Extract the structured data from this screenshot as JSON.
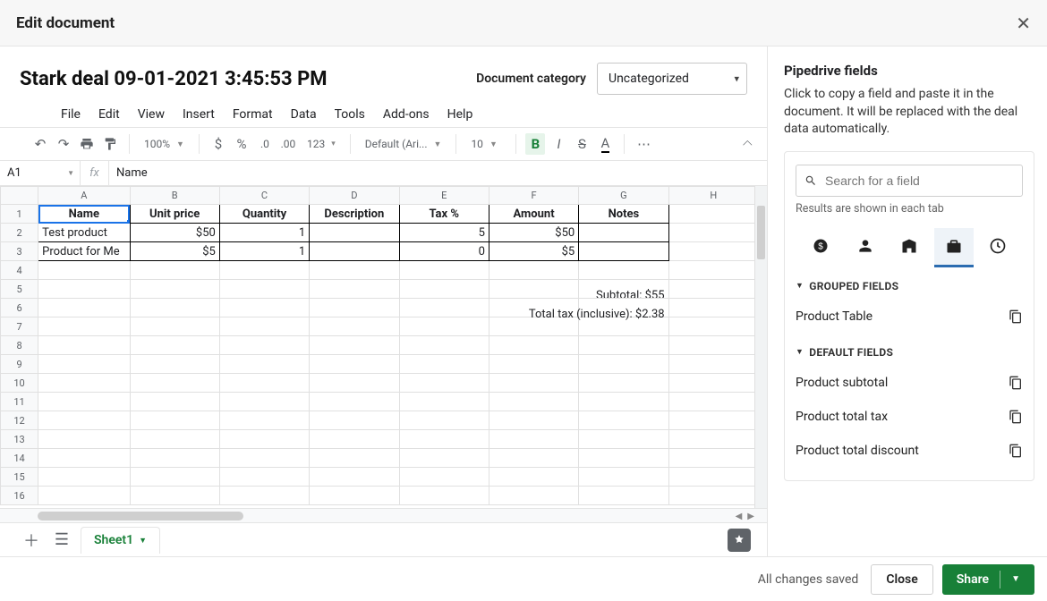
{
  "modal": {
    "title": "Edit document"
  },
  "doc": {
    "title": "Stark deal 09-01-2021 3:45:53 PM",
    "category_label": "Document category",
    "category_value": "Uncategorized"
  },
  "menus": [
    "File",
    "Edit",
    "View",
    "Insert",
    "Format",
    "Data",
    "Tools",
    "Add-ons",
    "Help"
  ],
  "toolbar": {
    "zoom": "100%",
    "number_format": "123",
    "font": "Default (Ari...",
    "font_size": "10"
  },
  "name_box": "A1",
  "formula_value": "Name",
  "columns": [
    "A",
    "B",
    "C",
    "D",
    "E",
    "F",
    "G",
    "H"
  ],
  "row_count": 16,
  "headers": [
    "Name",
    "Unit price",
    "Quantity",
    "Description",
    "Tax %",
    "Amount",
    "Notes"
  ],
  "rows": [
    {
      "name": "Test product",
      "unit_price": "$50",
      "quantity": "1",
      "description": "",
      "tax": "5",
      "amount": "$50",
      "notes": ""
    },
    {
      "name": "Product for Me",
      "unit_price": "$5",
      "quantity": "1",
      "description": "",
      "tax": "0",
      "amount": "$5",
      "notes": ""
    }
  ],
  "subtotal_line": "Subtotal: $55",
  "totaltax_line": "Total tax (inclusive): $2.38",
  "sheet_tab": "Sheet1",
  "right_panel": {
    "title": "Pipedrive fields",
    "description": "Click to copy a field and paste it in the document. It will be replaced with the deal data automatically.",
    "search_placeholder": "Search for a field",
    "hint": "Results are shown in each tab",
    "grouped_label": "GROUPED FIELDS",
    "grouped_fields": [
      "Product Table"
    ],
    "default_label": "DEFAULT FIELDS",
    "default_fields": [
      "Product subtotal",
      "Product total tax",
      "Product total discount"
    ]
  },
  "footer": {
    "saved": "All changes saved",
    "close": "Close",
    "share": "Share"
  }
}
